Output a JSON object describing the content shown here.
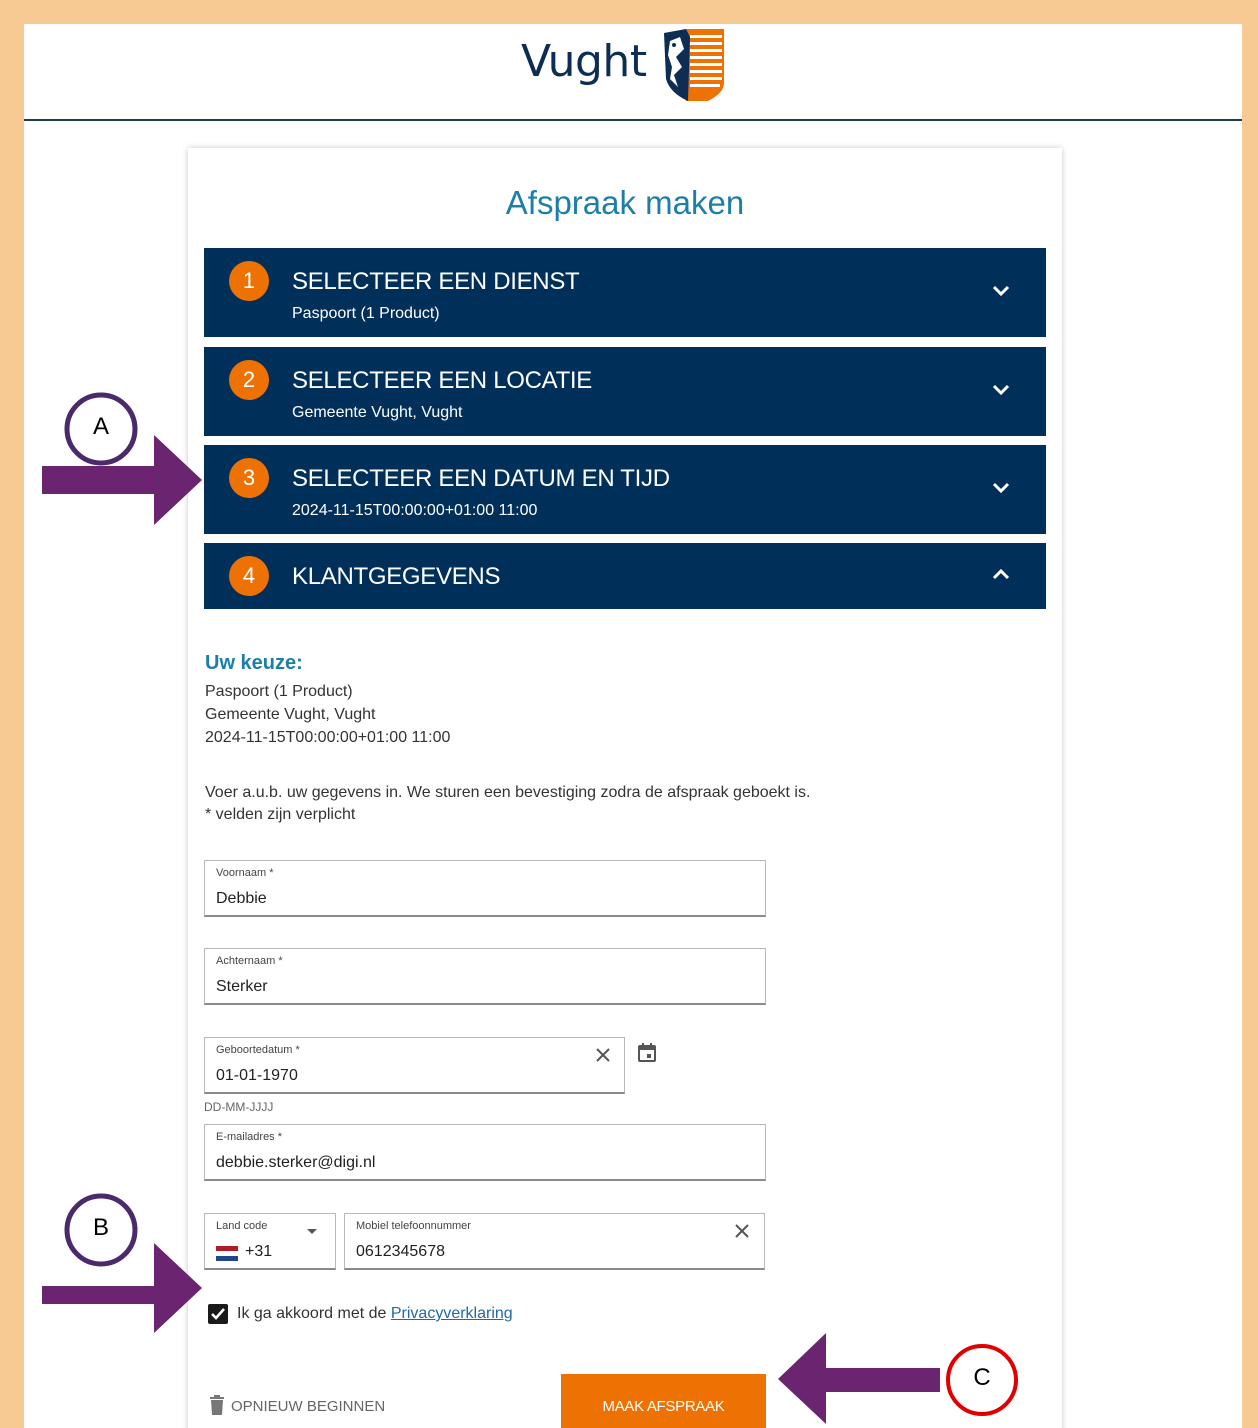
{
  "header": {
    "logo_text": "Vught"
  },
  "page_title": "Afspraak maken",
  "steps": [
    {
      "number": "1",
      "title": "SELECTEER EEN DIENST",
      "subtitle": "Paspoort (1 Product)"
    },
    {
      "number": "2",
      "title": "SELECTEER EEN LOCATIE",
      "subtitle": "Gemeente Vught, Vught"
    },
    {
      "number": "3",
      "title": "SELECTEER EEN DATUM EN TIJD",
      "subtitle": "2024-11-15T00:00:00+01:00 11:00"
    },
    {
      "number": "4",
      "title": "KLANTGEGEVENS"
    }
  ],
  "summary": {
    "title": "Uw keuze:",
    "lines": [
      "Paspoort (1 Product)",
      "Gemeente Vught, Vught",
      "2024-11-15T00:00:00+01:00 11:00"
    ]
  },
  "intro": {
    "line1": "Voer a.u.b. uw gegevens in. We sturen een bevestiging zodra de afspraak geboekt is.",
    "line2": "* velden zijn verplicht"
  },
  "form": {
    "first_name": {
      "label": "Voornaam *",
      "value": "Debbie"
    },
    "last_name": {
      "label": "Achternaam *",
      "value": "Sterker"
    },
    "birth_date": {
      "label": "Geboortedatum *",
      "value": "01-01-1970",
      "hint": "DD-MM-JJJJ"
    },
    "email": {
      "label": "E-mailadres *",
      "value": "debbie.sterker@digi.nl"
    },
    "country_code": {
      "label": "Land code",
      "value": "+31"
    },
    "phone": {
      "label": "Mobiel telefoonnummer",
      "value": "0612345678"
    }
  },
  "consent": {
    "checked": true,
    "text": "Ik ga akkoord met de ",
    "link": "Privacyverklaring"
  },
  "actions": {
    "restart_label": "OPNIEUW BEGINNEN",
    "submit_label": "MAAK AFSPRAAK"
  },
  "annotations": {
    "a": "A",
    "b": "B",
    "c": "C"
  },
  "colors": {
    "brand_navy": "#002f5a",
    "brand_orange": "#ee7203",
    "title_blue": "#1d7fa8",
    "frame": "#f6ca92",
    "arrow": "#6b2470"
  }
}
